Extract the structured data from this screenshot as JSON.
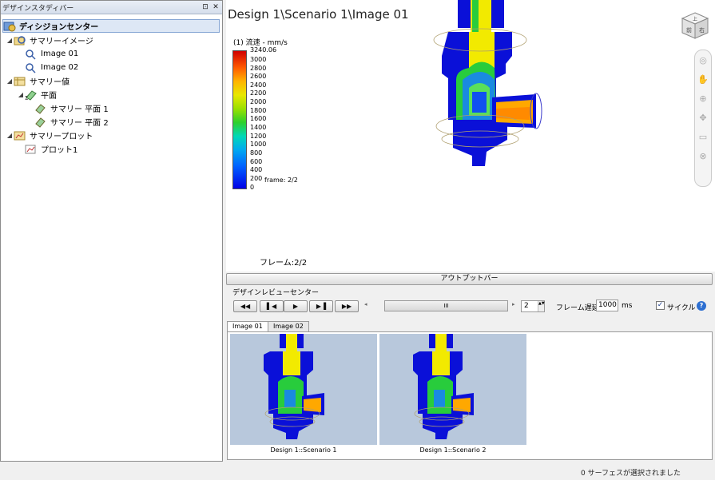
{
  "left_panel": {
    "header_title": "デザインスタディバー",
    "pin_glyph": "⊡",
    "close_glyph": "✕",
    "tree": [
      {
        "label": "ディシジョンセンター",
        "level": 0,
        "icon": "decision-center-icon",
        "bold": true,
        "selected": true
      },
      {
        "label": "サマリーイメージ",
        "level": 1,
        "icon": "summary-image-icon",
        "expander": "◢"
      },
      {
        "label": "Image 01",
        "level": 2,
        "icon": "image-item-icon"
      },
      {
        "label": "Image 02",
        "level": 2,
        "icon": "image-item-icon"
      },
      {
        "label": "サマリー値",
        "level": 1,
        "icon": "summary-value-icon",
        "expander": "◢"
      },
      {
        "label": "平面",
        "level": 2,
        "icon": "plane-icon",
        "expander": "◢"
      },
      {
        "label": "サマリー 平面 1",
        "level": 3,
        "icon": "summary-plane-icon"
      },
      {
        "label": "サマリー 平面 2",
        "level": 3,
        "icon": "summary-plane-icon"
      },
      {
        "label": "サマリープロット",
        "level": 1,
        "icon": "summary-plot-icon",
        "expander": "◢"
      },
      {
        "label": "プロット1",
        "level": 2,
        "icon": "plot-item-icon"
      }
    ]
  },
  "viewport": {
    "title": "Design 1\\Scenario 1\\Image 01",
    "legend_title": "(1) 流速 - mm/s",
    "legend_ticks": [
      "3240.06",
      "3000",
      "2800",
      "2600",
      "2400",
      "2200",
      "2000",
      "1800",
      "1600",
      "1400",
      "1200",
      "1000",
      "800",
      "600",
      "400",
      "200",
      "0"
    ],
    "frame_mini": "frame: 2/2",
    "frame_label": "フレーム:2/2",
    "viewcube_labels": {
      "top": "上",
      "front": "前",
      "side": "右"
    }
  },
  "output_bar_label": "アウトプットバー",
  "review_center": {
    "label": "デザインレビューセンター",
    "buttons": [
      {
        "name": "first-frame-button",
        "glyph": "◀◀"
      },
      {
        "name": "prev-frame-button",
        "glyph": "▌◀"
      },
      {
        "name": "play-button",
        "glyph": "▶"
      },
      {
        "name": "next-frame-button",
        "glyph": "▶▐"
      },
      {
        "name": "last-frame-button",
        "glyph": "▶▶"
      }
    ],
    "slider_left_glyph": "◂",
    "slider_right_glyph": "▸",
    "slider_grip": "III",
    "frame_value": "2",
    "spin_glyphs": "▲▼",
    "delay_label": "フレーム遅延:",
    "delay_value": "1000",
    "delay_unit": "ms",
    "cycle_checked_glyph": "✓",
    "cycle_label": "サイクル",
    "cycle_checked": true,
    "help_glyph": "?"
  },
  "tabs": [
    {
      "label": "Image 01",
      "active": true
    },
    {
      "label": "Image 02",
      "active": false
    }
  ],
  "thumbnails": [
    {
      "caption": "Design 1::Scenario 1"
    },
    {
      "caption": "Design 1::Scenario 2"
    }
  ],
  "status_text": "0 サーフェスが選択されました",
  "colors": {
    "selection_bg": "#dde7f5",
    "part_blue": "#0a10d8",
    "flow_yellow": "#f2ea00",
    "flow_green": "#28cc3c",
    "flow_orange": "#ff8a00",
    "thumb_bg": "#b8c8dc",
    "help_blue": "#2d6fd1"
  }
}
